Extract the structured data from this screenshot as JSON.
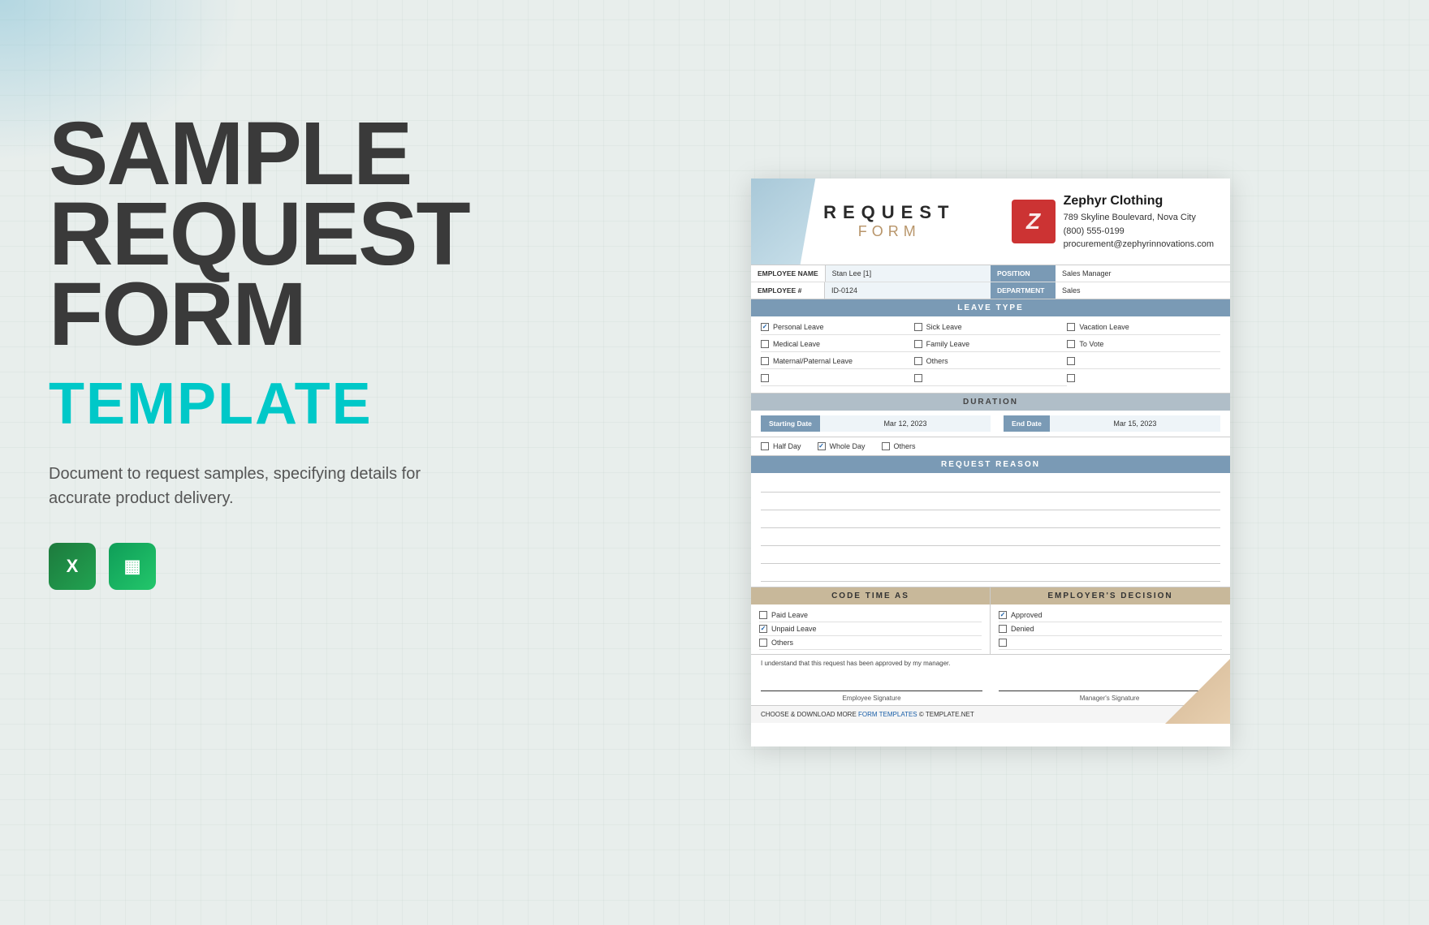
{
  "background": {
    "blob_color": "rgba(100,180,210,0.4)"
  },
  "left": {
    "title_line1": "SAMPLE",
    "title_line2": "REQUEST",
    "title_line3": "FORM",
    "subtitle": "TEMPLATE",
    "description": "Document to request samples, specifying details for accurate product delivery.",
    "icons": [
      {
        "type": "xl",
        "label": "X"
      },
      {
        "type": "sheets",
        "label": "≡"
      }
    ]
  },
  "document": {
    "header": {
      "request": "REQUEST",
      "form": "FORM",
      "company_name": "Zephyr Clothing",
      "company_address": "789 Skyline Boulevard, Nova City",
      "company_phone": "(800) 555-0199",
      "company_email": "procurement@zephyrinnovations.com"
    },
    "employee": {
      "name_label": "EMPLOYEE NAME",
      "name_value": "Stan Lee [1]",
      "number_label": "EMPLOYEE #",
      "number_value": "ID-0124",
      "position_label": "POSITION",
      "position_value": "Sales Manager",
      "department_label": "DEPARTMENT",
      "department_value": "Sales"
    },
    "leave_type": {
      "section_title": "LEAVE TYPE",
      "items": [
        {
          "label": "Personal Leave",
          "checked": true
        },
        {
          "label": "Sick Leave",
          "checked": false
        },
        {
          "label": "Vacation Leave",
          "checked": false
        },
        {
          "label": "Medical Leave",
          "checked": false
        },
        {
          "label": "Family Leave",
          "checked": false
        },
        {
          "label": "To Vote",
          "checked": false
        },
        {
          "label": "Maternal/Paternal Leave",
          "checked": false
        },
        {
          "label": "Others",
          "checked": false
        },
        {
          "label": "",
          "checked": false
        },
        {
          "label": "",
          "checked": false
        },
        {
          "label": "",
          "checked": false
        },
        {
          "label": "",
          "checked": false
        }
      ]
    },
    "duration": {
      "section_title": "DURATION",
      "start_label": "Starting Date",
      "start_value": "Mar 12, 2023",
      "end_label": "End Date",
      "end_value": "Mar 15, 2023",
      "half_day_label": "Half Day",
      "half_day_checked": false,
      "whole_day_label": "Whole Day",
      "whole_day_checked": true,
      "others_label": "Others",
      "others_checked": false
    },
    "request_reason": {
      "section_title": "REQUEST REASON",
      "lines": 6
    },
    "code_time": {
      "section_title": "CODE TIME AS",
      "items": [
        {
          "label": "Paid Leave",
          "checked": false
        },
        {
          "label": "Unpaid Leave",
          "checked": true
        },
        {
          "label": "Others",
          "checked": false
        }
      ]
    },
    "employer_decision": {
      "section_title": "EMPLOYER'S DECISION",
      "items": [
        {
          "label": "Approved",
          "checked": true
        },
        {
          "label": "Denied",
          "checked": false
        },
        {
          "label": "",
          "checked": false
        }
      ]
    },
    "signature": {
      "notice": "I understand that this request has been approved by my manager.",
      "employee_label": "Employee Signature",
      "manager_label": "Manager's Signature"
    },
    "footer": {
      "text": "CHOOSE & DOWNLOAD MORE",
      "link_text": "FORM TEMPLATES",
      "suffix": "© TEMPLATE.NET"
    }
  }
}
